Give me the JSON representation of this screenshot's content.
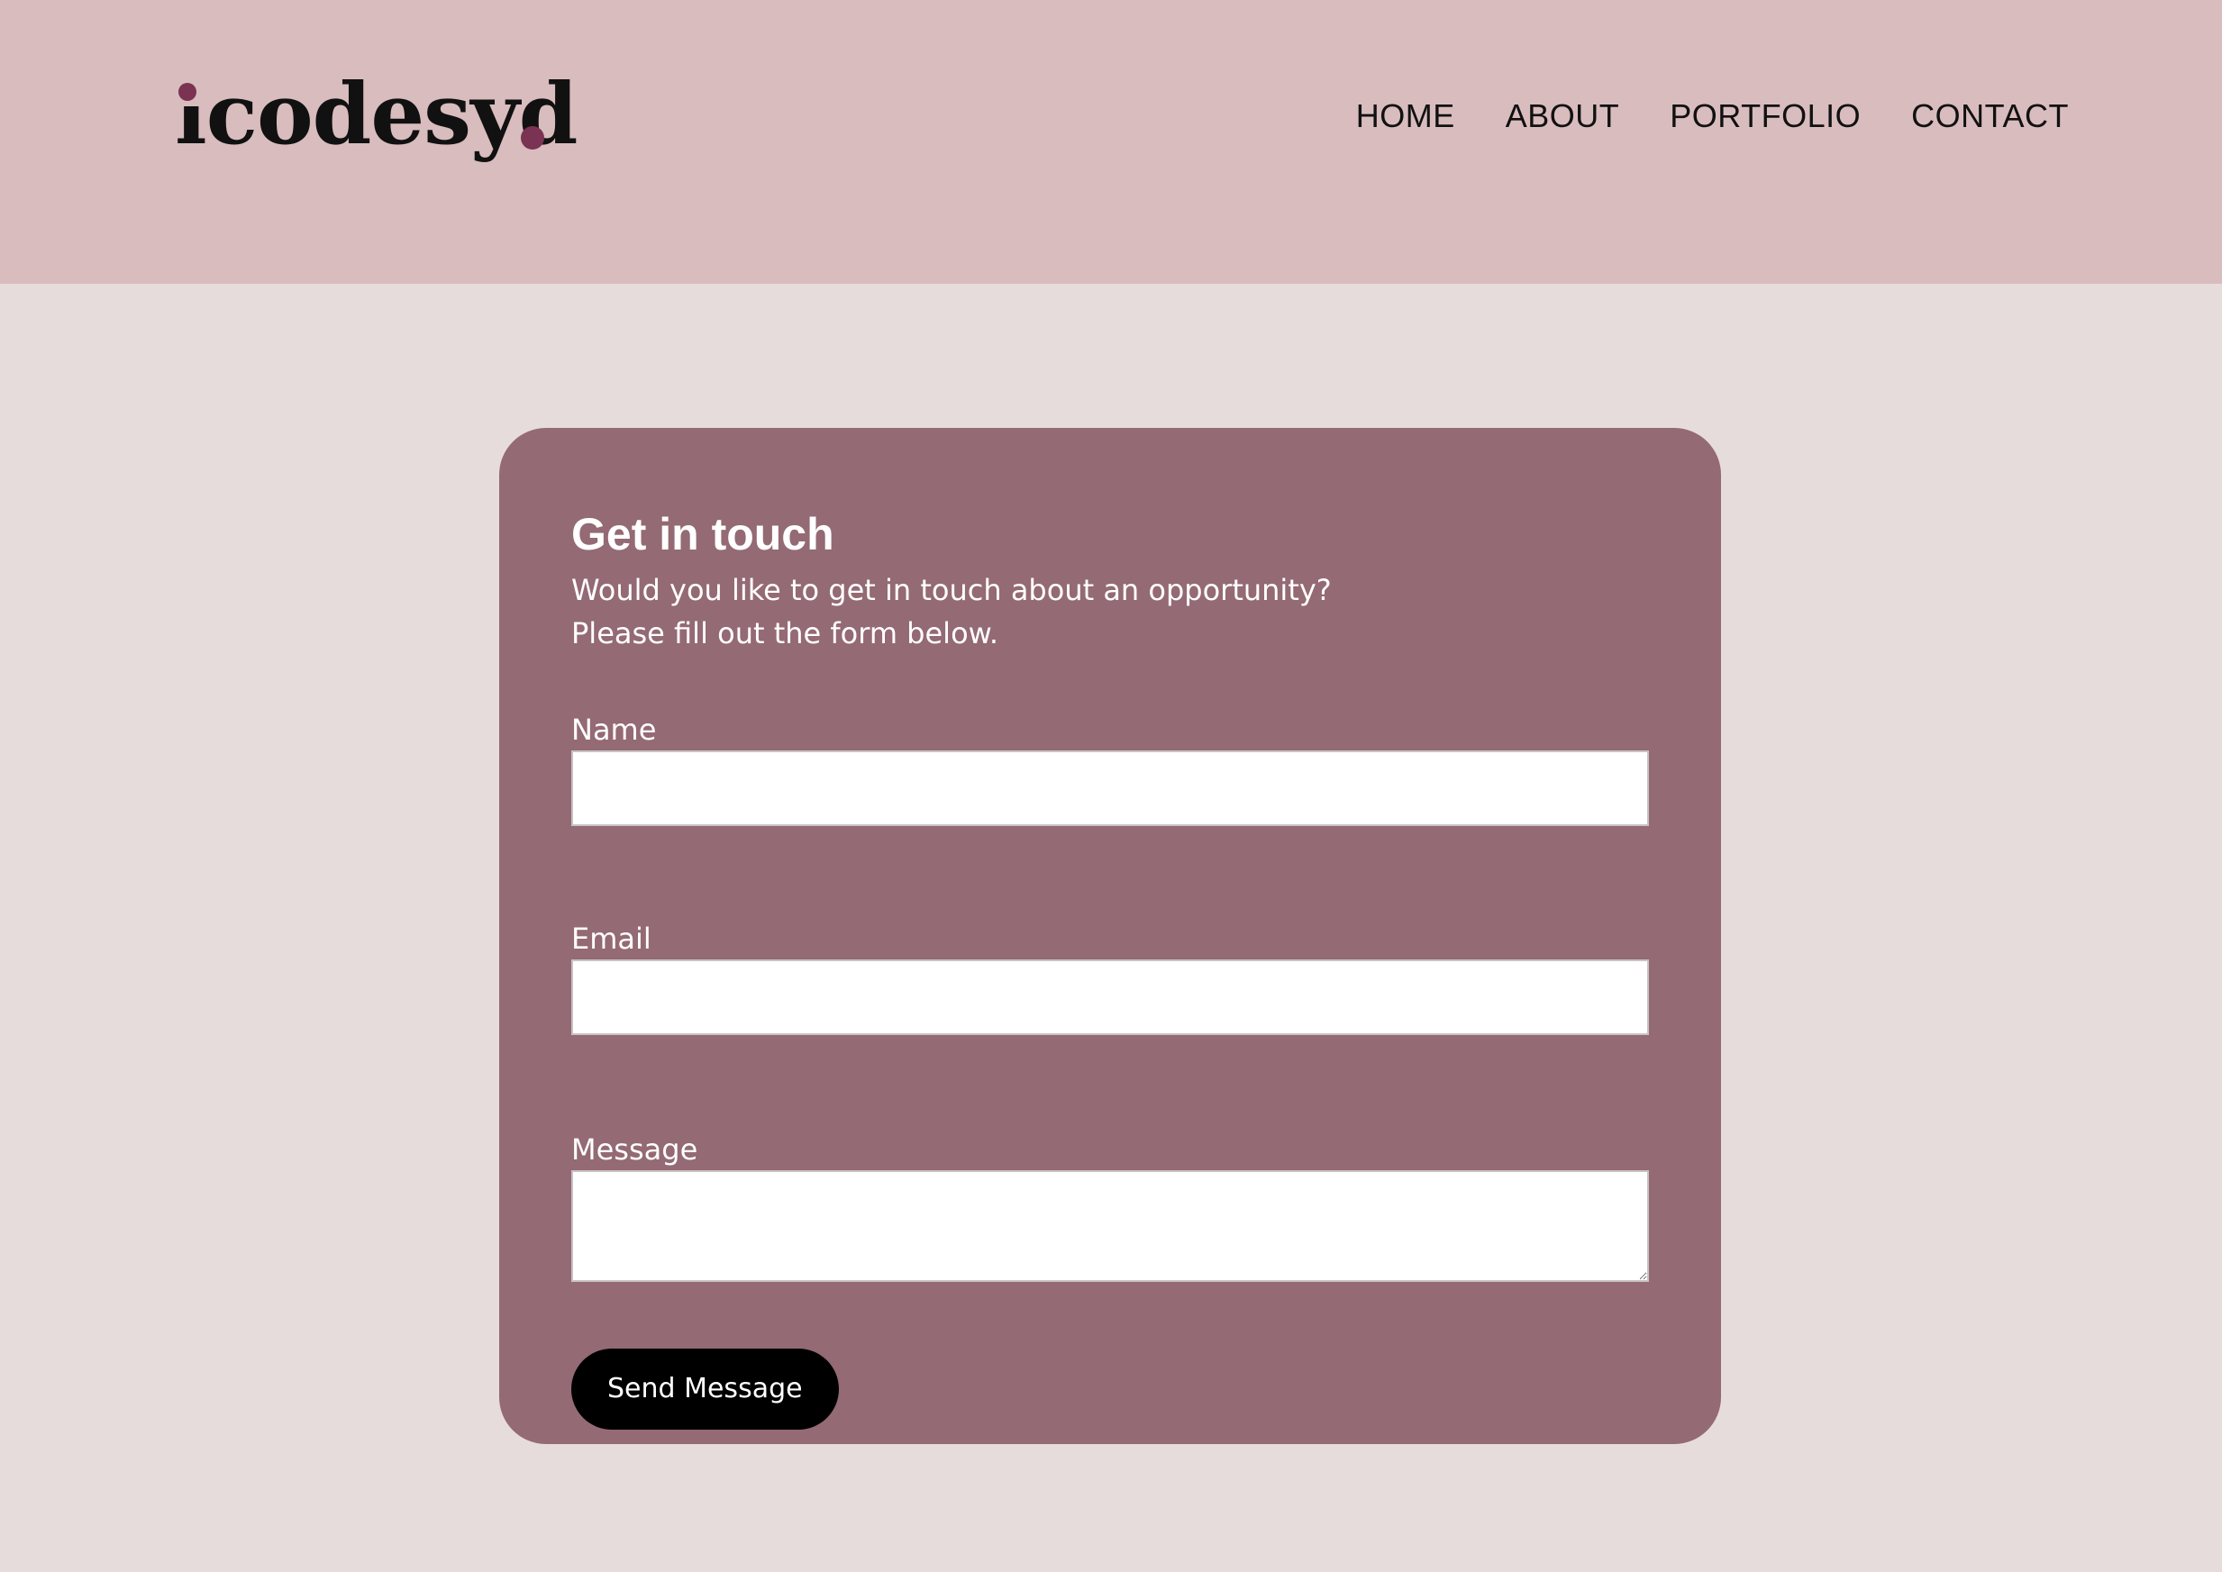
{
  "header": {
    "logo_text": "icodesyd",
    "nav": [
      {
        "label": "HOME"
      },
      {
        "label": "ABOUT"
      },
      {
        "label": "PORTFOLIO"
      },
      {
        "label": "CONTACT"
      }
    ]
  },
  "colors": {
    "header_bg": "#d9bcbe",
    "page_bg": "#e7dcdc",
    "card_bg": "#946a74",
    "logo_accent": "#7a3352",
    "button_bg": "#000000"
  },
  "contact": {
    "title": "Get in touch",
    "subtitle": "Would you like to get in touch about an opportunity? Please fill out the form below.",
    "fields": {
      "name": {
        "label": "Name",
        "value": ""
      },
      "email": {
        "label": "Email",
        "value": ""
      },
      "message": {
        "label": "Message",
        "value": ""
      }
    },
    "submit_label": "Send Message"
  }
}
